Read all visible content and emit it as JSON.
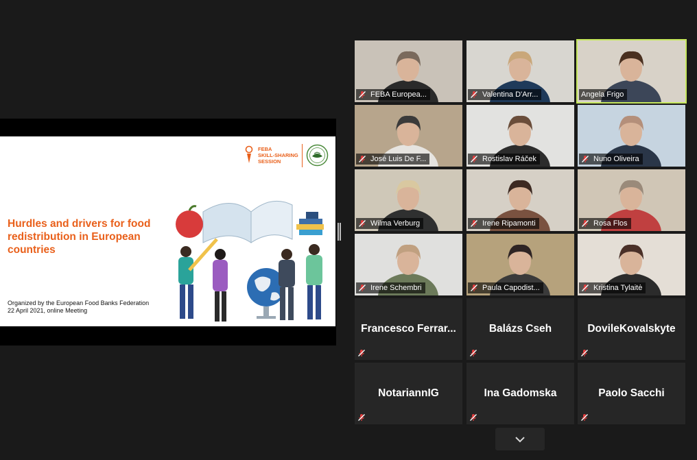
{
  "shared_slide": {
    "logo_line1": "FEBA",
    "logo_line2": "SKILL-SHARING",
    "logo_line3": "SESSION",
    "title": "Hurdles and drivers for food redistribution in European countries",
    "organizer_line": "Organized by the European Food Banks Federation",
    "date_line": "22 April 2021, online Meeting",
    "colors": {
      "accent": "#e9601b",
      "background": "#ffffff"
    }
  },
  "gallery": {
    "active_speaker_color": "#c6e85d",
    "video_tiles": [
      {
        "name": "FEBA Europea...",
        "muted": true
      },
      {
        "name": "Valentina D'Arr...",
        "muted": true
      },
      {
        "name": "Angela Frigo",
        "muted": false,
        "active": true
      },
      {
        "name": "José Luis De F...",
        "muted": true
      },
      {
        "name": "Rostislav Ráček",
        "muted": true
      },
      {
        "name": "Nuno Oliveira",
        "muted": true
      },
      {
        "name": "Wilma Verburg",
        "muted": true
      },
      {
        "name": "Irene Ripamonti",
        "muted": true
      },
      {
        "name": "Rosa Flos",
        "muted": true
      },
      {
        "name": "Irene Schembri",
        "muted": true
      },
      {
        "name": "Paula Capodist...",
        "muted": true
      },
      {
        "name": "Kristina Tylaitė",
        "muted": true
      }
    ],
    "name_tiles": [
      {
        "name": "Francesco  Ferrar...",
        "muted": true
      },
      {
        "name": "Balázs Cseh",
        "muted": true
      },
      {
        "name": "DovileKovalskyte",
        "muted": true
      },
      {
        "name": "NotariannIG",
        "muted": true
      },
      {
        "name": "Ina Gadomska",
        "muted": true
      },
      {
        "name": "Paolo Sacchi",
        "muted": true
      }
    ]
  },
  "controls": {
    "next_page_icon": "chevron-down-icon",
    "split_handle_icon": "drag-handle-icon"
  }
}
